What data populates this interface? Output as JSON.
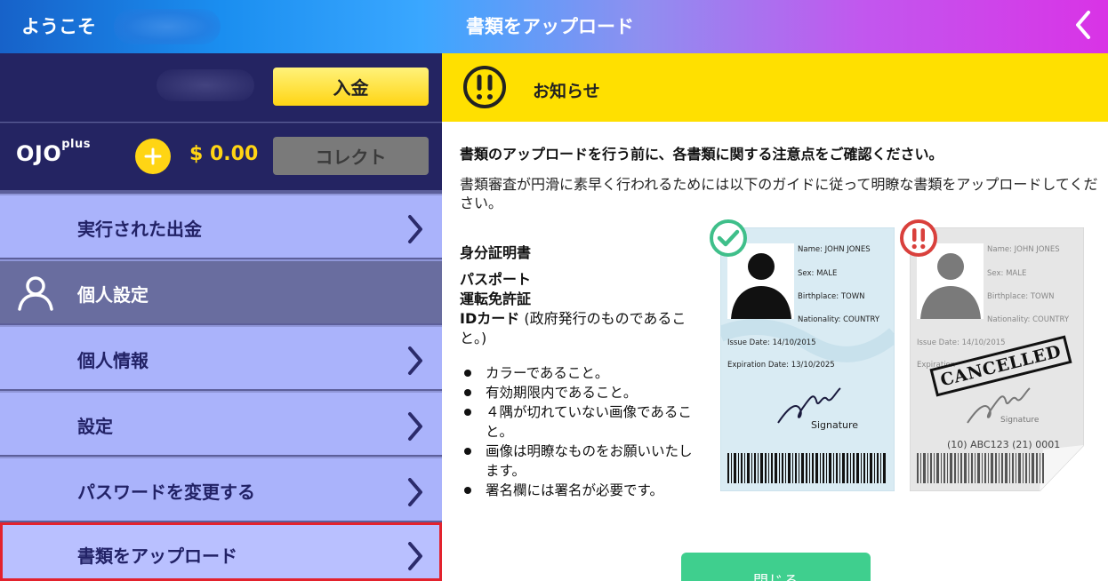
{
  "header": {
    "welcome": "ようこそ",
    "title": "書類をアップロード",
    "back_icon": "chevron-left-icon"
  },
  "wallet": {
    "deposit_label": "入金",
    "brand_main": "OJO",
    "brand_sup": "plus",
    "plus_icon": "plus-icon",
    "amount": "$ 0.00",
    "collect_label": "コレクト"
  },
  "menu": {
    "items": [
      {
        "label": "実行された出金"
      },
      {
        "label": "個人設定"
      },
      {
        "label": "個人情報"
      },
      {
        "label": "設定"
      },
      {
        "label": "パスワードを変更する"
      },
      {
        "label": "書類をアップロード"
      }
    ]
  },
  "notice": {
    "title": "お知らせ",
    "intro": "書類のアップロードを行う前に、各書類に関する注意点をご確認ください。",
    "guide": "書類審査が円滑に素早く行われるためには以下のガイドに従って明瞭な書類をアップロードしてください。",
    "doc_heading": "身分証明書",
    "doc_passport": "パスポート",
    "doc_license": "運転免許証",
    "doc_id": "IDカード",
    "doc_id_note": " (政府発行のものであること。)",
    "requirements": [
      "カラーであること。",
      "有効期限内であること。",
      "４隅が切れていない画像であること。",
      "画像は明瞭なものをお願いいたします。",
      "署名欄には署名が必要です。"
    ],
    "close_label": "閉じる"
  },
  "cards": {
    "valid": {
      "name": "Name: JOHN JONES",
      "sex": "Sex: MALE",
      "birthplace": "Birthplace: TOWN",
      "nationality": "Nationality: COUNTRY",
      "issue": "Issue Date: 14/10/2015",
      "expiry": "Expiration Date: 13/10/2025",
      "signature": "Signature"
    },
    "invalid": {
      "name": "Name: JOHN JONES",
      "sex": "Sex: MALE",
      "birthplace": "Birthplace: TOWN",
      "nationality": "Nationality: COUNTRY",
      "issue": "Issue Date: 14/10/2015",
      "expiry": "Expiration",
      "stamp": "CANCELLED",
      "signature": "Signature",
      "number": "(10) ABC123 (21) 0001"
    }
  },
  "colors": {
    "sidebar_dark": "#242462",
    "menu_light": "#aab3fb",
    "accent_yellow": "#ffe000",
    "selected_border": "#e3222d",
    "close_green": "#3fcf8e"
  }
}
